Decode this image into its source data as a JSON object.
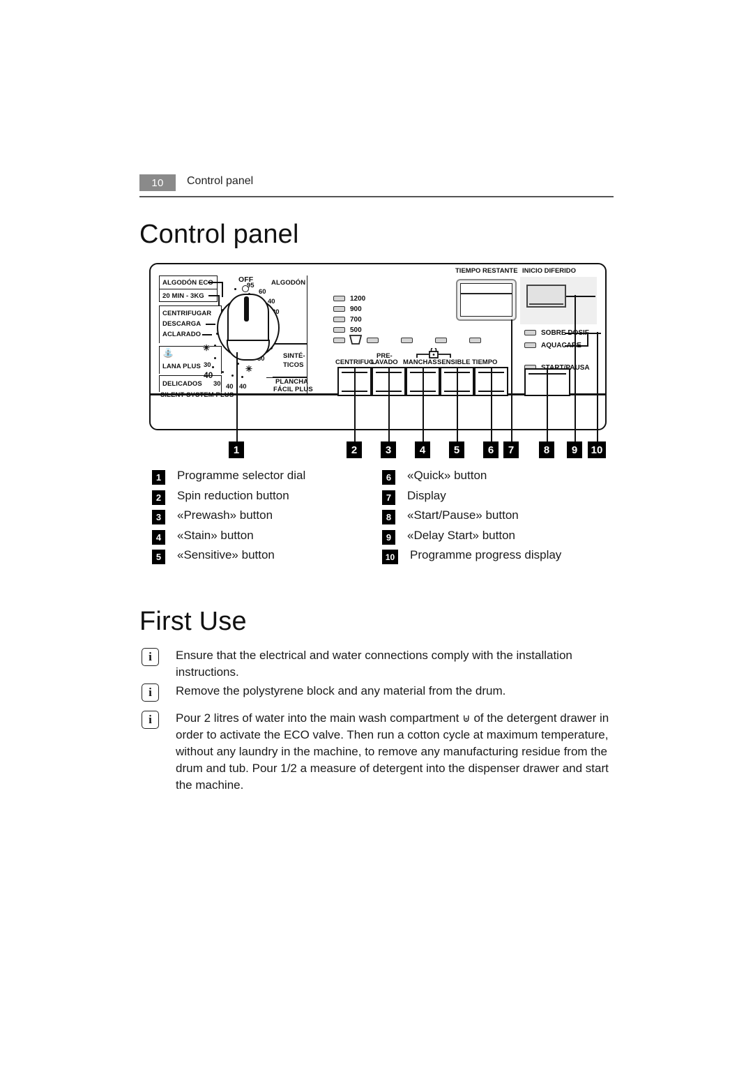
{
  "header": {
    "page_number": "10",
    "section": "Control panel"
  },
  "titles": {
    "control_panel": "Control panel",
    "first_use": "First Use"
  },
  "control_panel_diagram": {
    "dial": {
      "left_labels": [
        "ALGODÓN ECO",
        "20 MIN - 3KG",
        "CENTRIFUGAR",
        "DESCARGA",
        "ACLARADO",
        "LANA PLUS",
        "DELICADOS"
      ],
      "bottom_label": "SILENT SYSTEM PLUS",
      "off_label": "OFF",
      "right_labels": [
        "ALGODÓN",
        "SINTÉ-",
        "TICOS",
        "PLANCHA",
        "FÁCIL PLUS"
      ],
      "right_temps": [
        "95",
        "60",
        "40",
        "30",
        "✳",
        "60",
        "40",
        "30",
        "✳"
      ],
      "left_temps": [
        "30",
        "✳",
        "30",
        "40",
        "40"
      ],
      "wool_icon": "wool-basket-icon"
    },
    "spin_speeds": [
      "1200",
      "900",
      "700",
      "500"
    ],
    "rinse_hold_icon": "rinse-hold-tub-icon",
    "child_lock_icon": "padlock-icon",
    "button_labels": [
      "CENTRIFUG.",
      "PRE-\nLAVADO",
      "MANCHAS",
      "SENSIBLE",
      "TIEMPO"
    ],
    "button_labels_flat": [
      "CENTRIFUG.",
      "PRE-",
      "LAVADO",
      "MANCHAS",
      "SENSIBLE",
      "TIEMPO"
    ],
    "display_label": "TIEMPO RESTANTE",
    "delay_label": "INICIO DIFERIDO",
    "status_leds": [
      "SOBRE DOSIF",
      "AQUACARE"
    ],
    "start_pause_label": "START/PAUSA"
  },
  "callouts": [
    "1",
    "2",
    "3",
    "4",
    "5",
    "6",
    "7",
    "8",
    "9",
    "10"
  ],
  "legend": {
    "left": [
      {
        "n": "1",
        "label": "Programme selector dial"
      },
      {
        "n": "2",
        "label": "Spin reduction button"
      },
      {
        "n": "3",
        "label": "«Prewash» button"
      },
      {
        "n": "4",
        "label": "«Stain» button"
      },
      {
        "n": "5",
        "label": "«Sensitive» button"
      }
    ],
    "right": [
      {
        "n": "6",
        "label": "«Quick» button"
      },
      {
        "n": "7",
        "label": "Display"
      },
      {
        "n": "8",
        "label": "«Start/Pause» button"
      },
      {
        "n": "9",
        "label": "«Delay Start» button"
      },
      {
        "n": "10",
        "label": "Programme progress display"
      }
    ]
  },
  "first_use_notes": [
    {
      "icon": "i",
      "text": "Ensure that the electrical and water connections comply with the installation instructions."
    },
    {
      "icon": "i",
      "text": "Remove the polystyrene block and  any material from the drum."
    },
    {
      "icon": "i",
      "text_before": "Pour 2 litres of water into the main wash compartment ",
      "inline_icon": "⊎",
      "text_after": " of the detergent drawer in order to activate the ECO valve. Then run a cotton cycle at maximum temperature, without any laundry in the machine, to remove any manufacturing residue from the drum and tub. Pour 1/2 a measure of detergent into the dispenser drawer and start the machine."
    }
  ],
  "colors": {
    "header_badge": "#8a8a8a",
    "ink": "#111111",
    "panel_shade": "#efefef",
    "led_fill": "#d4d4d4"
  }
}
